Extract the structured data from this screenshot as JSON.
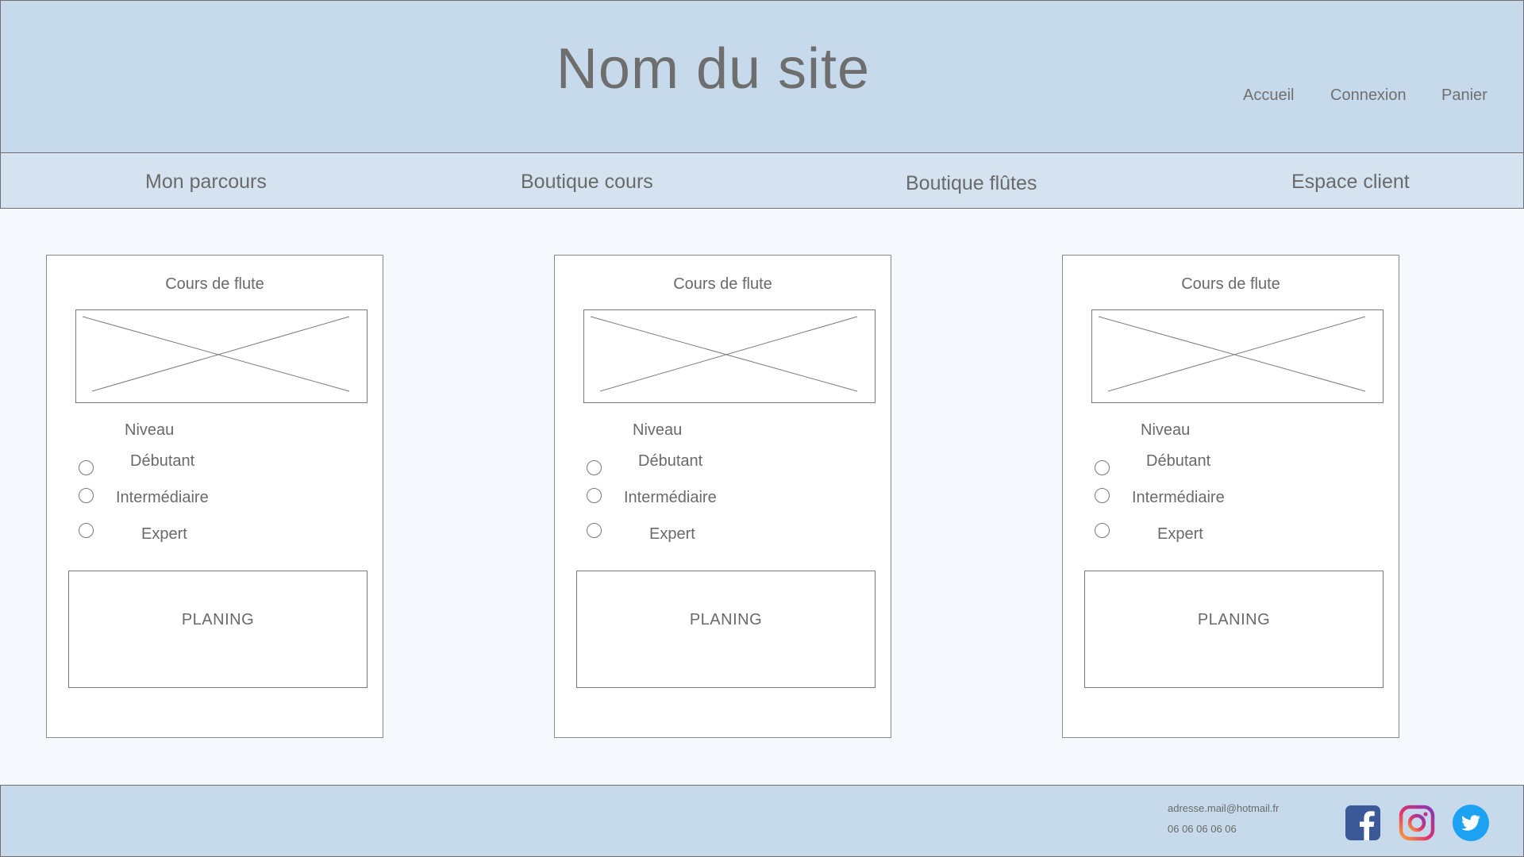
{
  "header": {
    "site_title": "Nom du site",
    "links": [
      "Accueil",
      "Connexion",
      "Panier"
    ]
  },
  "nav": {
    "items": [
      "Mon parcours",
      "Boutique cours",
      "Boutique flûtes",
      "Espace client"
    ]
  },
  "cards": [
    {
      "title": "Cours de flute",
      "level_label": "Niveau",
      "options": [
        "Débutant",
        "Intermédiaire",
        "Expert"
      ],
      "planning_label": "PLANING"
    },
    {
      "title": "Cours de flute",
      "level_label": "Niveau",
      "options": [
        "Débutant",
        "Intermédiaire",
        "Expert"
      ],
      "planning_label": "PLANING"
    },
    {
      "title": "Cours de flute",
      "level_label": "Niveau",
      "options": [
        "Débutant",
        "Intermédiaire",
        "Expert"
      ],
      "planning_label": "PLANING"
    }
  ],
  "footer": {
    "email": "adresse.mail@hotmail.fr",
    "phone": "06 06 06 06 06",
    "social_icons": [
      "facebook-icon",
      "instagram-icon",
      "twitter-icon"
    ]
  },
  "colors": {
    "header_bg": "#c6daeb",
    "nav_bg": "#d4e3ef",
    "page_bg": "#f5f9fd",
    "facebook": "#3b5998",
    "twitter": "#1da1f2"
  }
}
